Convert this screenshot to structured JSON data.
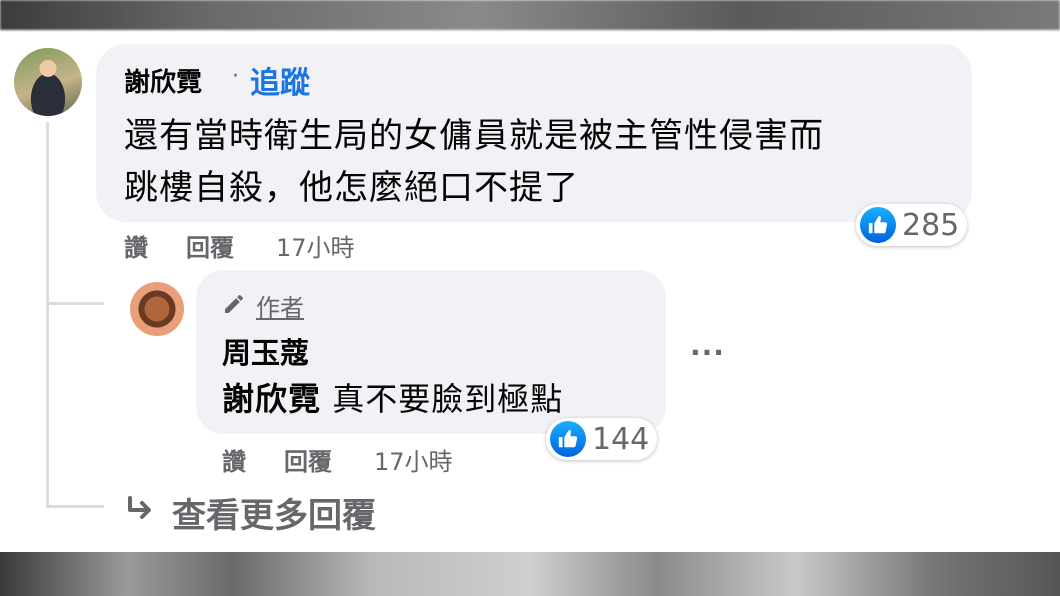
{
  "comment": {
    "author": "謝欣霓",
    "separator": "·",
    "follow_label": "追蹤",
    "text_lines": [
      "還有當時衛生局的女傭員就是被主管性侵害而",
      "跳樓自殺，他怎麼絕口不提了"
    ],
    "actions": {
      "like": "讚",
      "reply": "回覆",
      "time": "17小時"
    },
    "like_count": "285",
    "reaction_icon": "thumbs-up-icon"
  },
  "reply": {
    "badge_label": "作者",
    "badge_icon": "pencil-icon",
    "author": "周玉蔻",
    "mention": "謝欣霓",
    "text": " 真不要臉到極點",
    "actions": {
      "like": "讚",
      "reply": "回覆",
      "time": "17小時"
    },
    "like_count": "144",
    "more_icon": "more-options-icon",
    "more_glyph": "···"
  },
  "view_more_replies": {
    "label": "查看更多回覆",
    "icon": "reply-arrow-icon"
  },
  "colors": {
    "bubble": "#f0f2f5",
    "link": "#1b74e4",
    "secondary_text": "#65676b",
    "like_blue": "#1877f2"
  }
}
